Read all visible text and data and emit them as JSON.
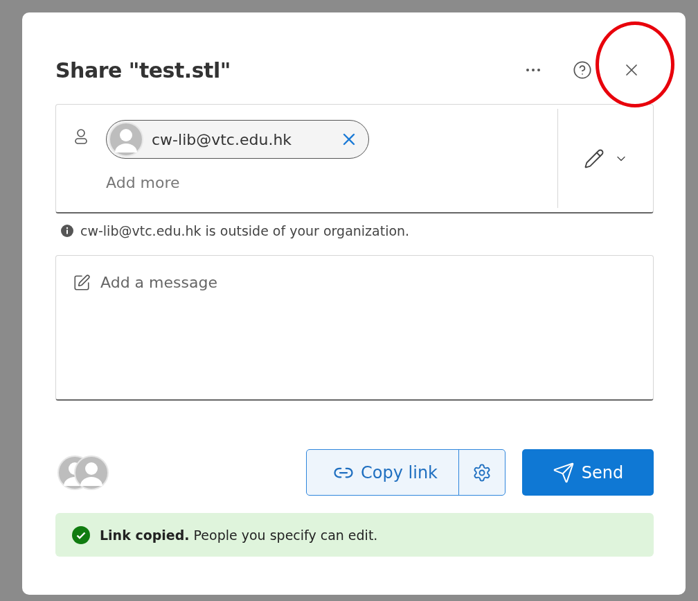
{
  "dialog": {
    "title": "Share \"test.stl\"",
    "recipients": [
      {
        "email": "cw-lib@vtc.edu.hk"
      }
    ],
    "add_more_placeholder": "Add more",
    "notice": "cw-lib@vtc.edu.hk is outside of your organization.",
    "message_placeholder": "Add a message",
    "copy_link": "Copy link",
    "send": "Send",
    "banner": "**Link copied.** People you specify can edit."
  }
}
